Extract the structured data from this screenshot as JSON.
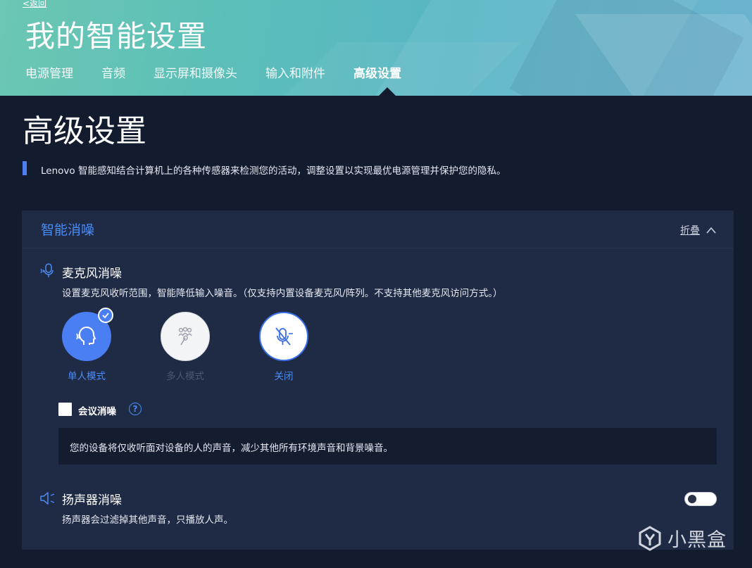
{
  "header": {
    "back_label": "<返回",
    "title": "我的智能设置",
    "tabs": [
      {
        "label": "电源管理"
      },
      {
        "label": "音频"
      },
      {
        "label": "显示屏和摄像头"
      },
      {
        "label": "输入和附件"
      },
      {
        "label": "高级设置",
        "active": true
      }
    ]
  },
  "page": {
    "title": "高级设置",
    "intro": "Lenovo 智能感知结合计算机上的各种传感器来检测您的活动，调整设置以实现最优电源管理并保护您的隐私。"
  },
  "section": {
    "title": "智能消噪",
    "collapse_label": "折叠",
    "mic": {
      "icon": "microphone-wave-icon",
      "title": "麦克风消噪",
      "desc": "设置麦克风收听范围，智能降低输入噪音。（仅支持内置设备麦克风/阵列。不支持其他麦克风访问方式。）",
      "modes": [
        {
          "label": "单人模式",
          "icon": "single-person-voice-icon",
          "selected": true
        },
        {
          "label": "多人模式",
          "icon": "group-microphone-icon",
          "disabled": true
        },
        {
          "label": "关闭",
          "icon": "microphone-off-icon"
        }
      ],
      "meeting_label": "会议消噪",
      "meeting_checked": false,
      "help_glyph": "?",
      "info": "您的设备将仅收听面对设备的人的声音，减少其他所有环境声音和背景噪音。"
    },
    "speaker": {
      "icon": "speaker-icon",
      "title": "扬声器消噪",
      "desc": "扬声器会过滤掉其他声音，只播放人声。",
      "enabled": false
    }
  },
  "watermark": {
    "text": "小黑盒"
  },
  "colors": {
    "accent": "#4c8cf5",
    "background": "#131b2e",
    "card": "#1f2a45",
    "header_gradient_start": "#6cc7b3",
    "header_gradient_end": "#6cb3cf"
  }
}
